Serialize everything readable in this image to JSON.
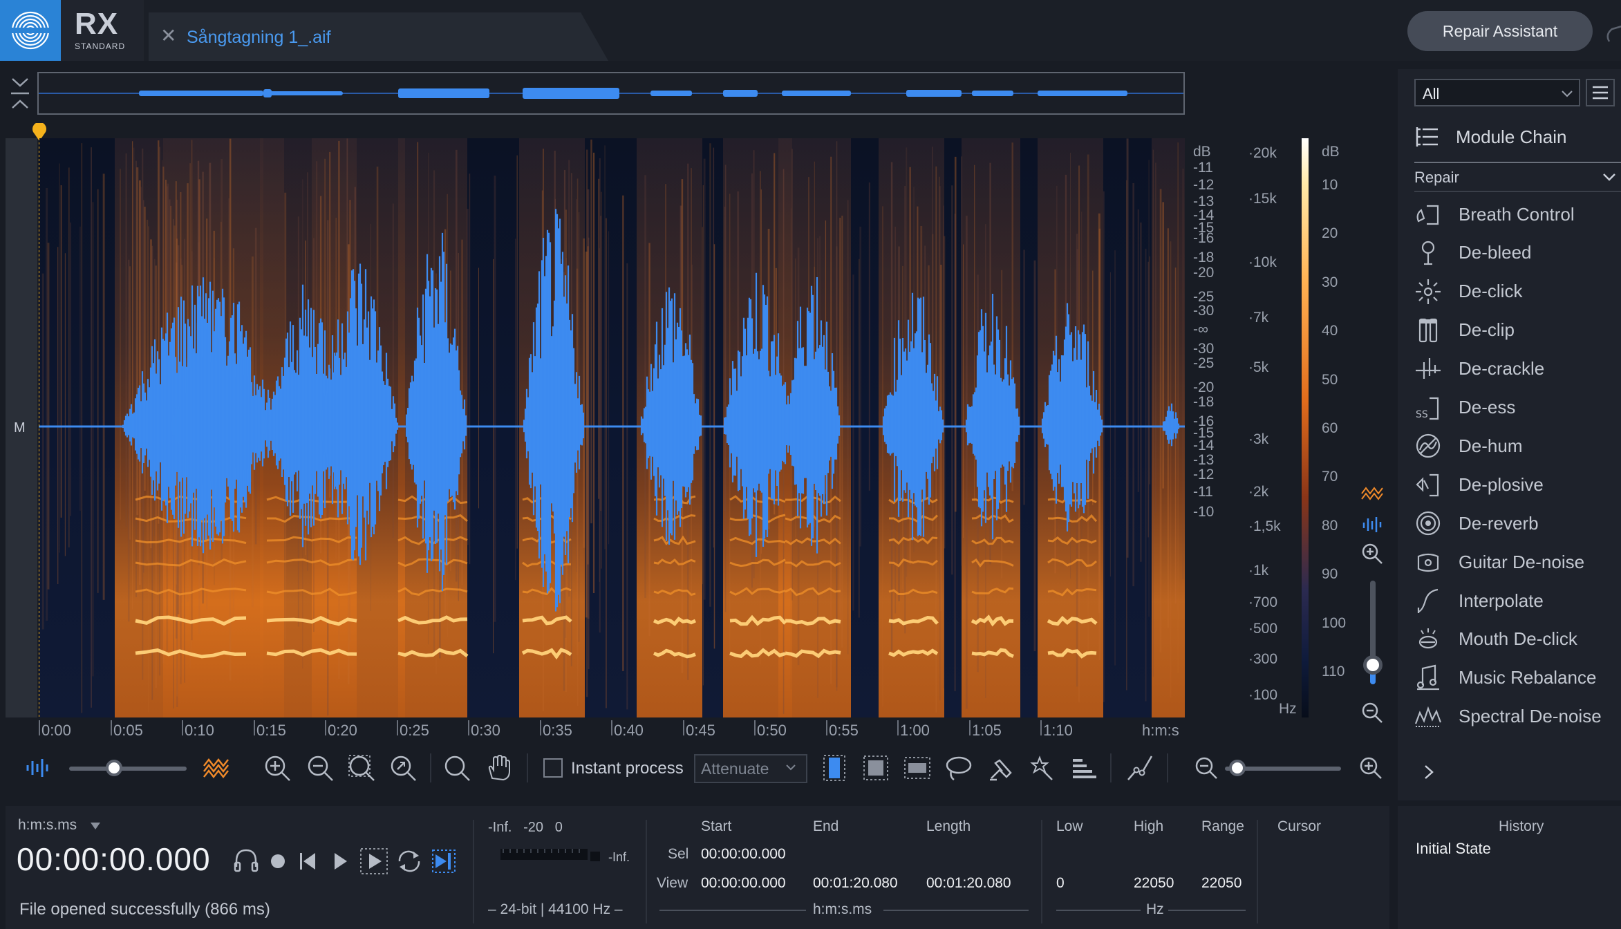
{
  "app": {
    "name": "RX",
    "edition": "STANDARD"
  },
  "tab": {
    "file_name": "Sångtagning 1_.aif"
  },
  "header": {
    "repair_assistant_label": "Repair Assistant"
  },
  "spectrogram": {
    "channel_label": "M",
    "db_unit": "dB",
    "db_ticks": [
      "-11",
      "-12",
      "-13",
      "-14",
      "-15",
      "-16",
      "-18",
      "-20",
      "-25",
      "-30",
      "-∞",
      "-30",
      "-25",
      "-20",
      "-18",
      "-16",
      "-15",
      "-14",
      "-13",
      "-12",
      "-11",
      "-10"
    ],
    "hz_ticks": [
      "20k",
      "15k",
      "10k",
      "7k",
      "5k",
      "3k",
      "2k",
      "1,5k",
      "1k",
      "700",
      "500",
      "300",
      "100"
    ],
    "hz_unit": "Hz",
    "colorbar_unit": "dB",
    "colorbar_ticks": [
      "10",
      "20",
      "30",
      "40",
      "50",
      "60",
      "70",
      "80",
      "90",
      "100",
      "110"
    ],
    "time_ticks": [
      "0:00",
      "0:05",
      "0:10",
      "0:15",
      "0:20",
      "0:25",
      "0:30",
      "0:35",
      "0:40",
      "0:45",
      "0:50",
      "0:55",
      "1:00",
      "1:05",
      "1:10"
    ],
    "time_unit": "h:m:s"
  },
  "toolbar": {
    "instant_process_label": "Instant process",
    "instant_process_checked": false,
    "mode_value": "Attenuate",
    "waveform_opacity": 0.38,
    "zoom_level": 0.0
  },
  "sidebar": {
    "filter_value": "All",
    "module_chain_label": "Module Chain",
    "category_label": "Repair",
    "modules": [
      {
        "label": "Breath Control",
        "icon": "breath-control-icon"
      },
      {
        "label": "De-bleed",
        "icon": "de-bleed-icon"
      },
      {
        "label": "De-click",
        "icon": "de-click-icon"
      },
      {
        "label": "De-clip",
        "icon": "de-clip-icon"
      },
      {
        "label": "De-crackle",
        "icon": "de-crackle-icon"
      },
      {
        "label": "De-ess",
        "icon": "de-ess-icon"
      },
      {
        "label": "De-hum",
        "icon": "de-hum-icon"
      },
      {
        "label": "De-plosive",
        "icon": "de-plosive-icon"
      },
      {
        "label": "De-reverb",
        "icon": "de-reverb-icon"
      },
      {
        "label": "Guitar De-noise",
        "icon": "guitar-de-noise-icon"
      },
      {
        "label": "Interpolate",
        "icon": "interpolate-icon"
      },
      {
        "label": "Mouth De-click",
        "icon": "mouth-de-click-icon"
      },
      {
        "label": "Music Rebalance",
        "icon": "music-rebalance-icon"
      },
      {
        "label": "Spectral De-noise",
        "icon": "spectral-de-noise-icon"
      }
    ]
  },
  "status": {
    "time_format": "h:m:s.ms",
    "timecode": "00:00:00.000",
    "message": "File opened successfully (866 ms)",
    "meter_labels": "-Inf.   -20   0",
    "meter_peak": "-Inf.",
    "format": "– 24-bit | 44100 Hz –"
  },
  "selection": {
    "headers": {
      "start": "Start",
      "end": "End",
      "length": "Length",
      "low": "Low",
      "high": "High",
      "range": "Range",
      "cursor": "Cursor"
    },
    "sel_label": "Sel",
    "view_label": "View",
    "sel_start": "00:00:00.000",
    "view_start": "00:00:00.000",
    "view_end": "00:01:20.080",
    "view_length": "00:01:20.080",
    "low": "0",
    "high": "22050",
    "range": "22050",
    "time_unit": "h:m:s.ms",
    "freq_unit": "Hz"
  },
  "history": {
    "title": "History",
    "items": [
      "Initial State"
    ]
  },
  "colors": {
    "accent": "#2a83d6",
    "waveform": "#3d8bf0",
    "spectral_hot": "#ff9a30"
  }
}
